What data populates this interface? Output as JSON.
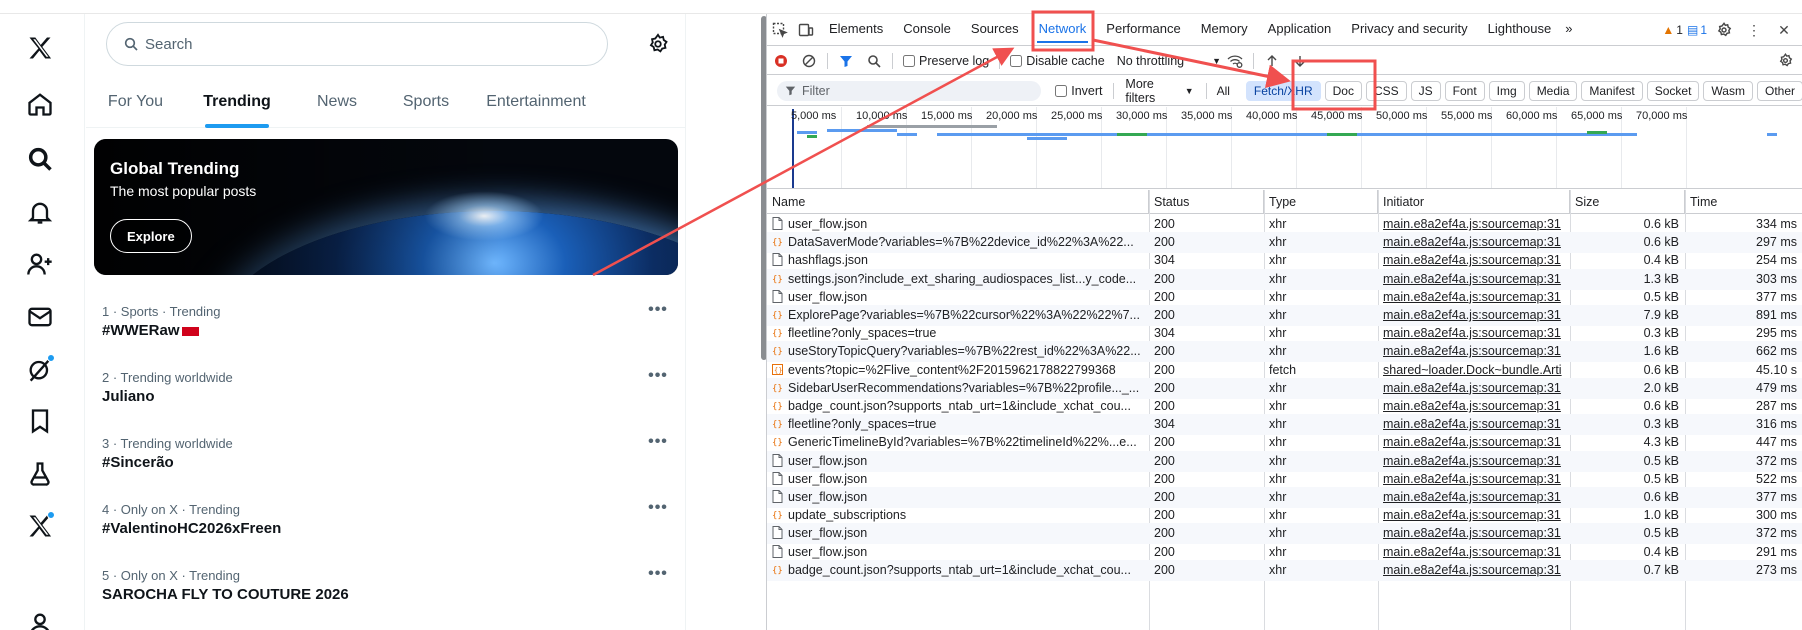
{
  "x_app": {
    "nav_icons": [
      "x-logo-icon",
      "home-icon",
      "search-icon",
      "bell-icon",
      "people-plus-icon",
      "mail-icon",
      "grok-slash-icon",
      "bookmark-icon",
      "flask-icon",
      "x-premium-icon",
      "profile-icon"
    ],
    "search": {
      "placeholder": "Search"
    },
    "tabs": [
      "For You",
      "Trending",
      "News",
      "Sports",
      "Entertainment"
    ],
    "active_tab": "Trending",
    "hero": {
      "title": "Global Trending",
      "subtitle": "The most popular posts",
      "button": "Explore"
    },
    "trends": [
      {
        "meta": "1 · Sports · Trending",
        "name": "#WWERaw"
      },
      {
        "meta": "2 · Trending worldwide",
        "name": "Juliano"
      },
      {
        "meta": "3 · Trending worldwide",
        "name": "#Sincerão"
      },
      {
        "meta": "4 · Only on X · Trending",
        "name": "#ValentinoHC2026xFreen"
      },
      {
        "meta": "5 · Only on X · Trending",
        "name": "SAROCHA FLY TO COUTURE 2026"
      }
    ],
    "more_glyph": "•••",
    "accent": "#1d9bf0"
  },
  "devtools": {
    "tabs": [
      "Elements",
      "Console",
      "Sources",
      "Network",
      "Performance",
      "Memory",
      "Application",
      "Privacy and security",
      "Lighthouse"
    ],
    "active_tab": "Network",
    "overflow": "»",
    "warnings": "1",
    "messages": "1",
    "toolbar": {
      "preserve_log": "Preserve log",
      "disable_cache": "Disable cache",
      "throttling": "No throttling"
    },
    "filter": {
      "placeholder": "Filter",
      "invert": "Invert",
      "more_filters": "More filters",
      "all": "All"
    },
    "type_filters": [
      "Fetch/XHR",
      "Doc",
      "CSS",
      "JS",
      "Font",
      "Img",
      "Media",
      "Manifest",
      "Socket",
      "Wasm",
      "Other"
    ],
    "active_type": "Fetch/XHR",
    "timeline_labels": [
      "5,000 ms",
      "10,000 ms",
      "15,000 ms",
      "20,000 ms",
      "25,000 ms",
      "30,000 ms",
      "35,000 ms",
      "40,000 ms",
      "45,000 ms",
      "50,000 ms",
      "55,000 ms",
      "60,000 ms",
      "65,000 ms",
      "70,000 ms"
    ],
    "columns": [
      "Name",
      "Status",
      "Type",
      "Initiator",
      "Size",
      "Time"
    ],
    "rows": [
      {
        "name": "user_flow.json",
        "icon": "doc",
        "status": "200",
        "type": "xhr",
        "initiator": "main.e8a2ef4a.js:sourcemap:31",
        "size": "0.6 kB",
        "time": "334 ms"
      },
      {
        "name": "DataSaverMode?variables=%7B%22device_id%22%3A%22...",
        "icon": "json",
        "status": "200",
        "type": "xhr",
        "initiator": "main.e8a2ef4a.js:sourcemap:31",
        "size": "0.6 kB",
        "time": "297 ms"
      },
      {
        "name": "hashflags.json",
        "icon": "doc",
        "status": "304",
        "type": "xhr",
        "initiator": "main.e8a2ef4a.js:sourcemap:31",
        "size": "0.4 kB",
        "time": "254 ms"
      },
      {
        "name": "settings.json?include_ext_sharing_audiospaces_list...y_code...",
        "icon": "json",
        "status": "200",
        "type": "xhr",
        "initiator": "main.e8a2ef4a.js:sourcemap:31",
        "size": "1.3 kB",
        "time": "303 ms"
      },
      {
        "name": "user_flow.json",
        "icon": "doc",
        "status": "200",
        "type": "xhr",
        "initiator": "main.e8a2ef4a.js:sourcemap:31",
        "size": "0.5 kB",
        "time": "377 ms"
      },
      {
        "name": "ExplorePage?variables=%7B%22cursor%22%3A%22%22%7...",
        "icon": "json",
        "status": "200",
        "type": "xhr",
        "initiator": "main.e8a2ef4a.js:sourcemap:31",
        "size": "7.9 kB",
        "time": "891 ms"
      },
      {
        "name": "fleetline?only_spaces=true",
        "icon": "json",
        "status": "304",
        "type": "xhr",
        "initiator": "main.e8a2ef4a.js:sourcemap:31",
        "size": "0.3 kB",
        "time": "295 ms"
      },
      {
        "name": "useStoryTopicQuery?variables=%7B%22rest_id%22%3A%22...",
        "icon": "json",
        "status": "200",
        "type": "xhr",
        "initiator": "main.e8a2ef4a.js:sourcemap:31",
        "size": "1.6 kB",
        "time": "662 ms"
      },
      {
        "name": "events?topic=%2Flive_content%2F2015962178822799368",
        "icon": "event",
        "status": "200",
        "type": "fetch",
        "initiator": "shared~loader.Dock~bundle.Arti",
        "size": "0.6 kB",
        "time": "45.10 s"
      },
      {
        "name": "SidebarUserRecommendations?variables=%7B%22profile..._...",
        "icon": "json",
        "status": "200",
        "type": "xhr",
        "initiator": "main.e8a2ef4a.js:sourcemap:31",
        "size": "2.0 kB",
        "time": "479 ms"
      },
      {
        "name": "badge_count.json?supports_ntab_urt=1&include_xchat_cou...",
        "icon": "json",
        "status": "200",
        "type": "xhr",
        "initiator": "main.e8a2ef4a.js:sourcemap:31",
        "size": "0.6 kB",
        "time": "287 ms"
      },
      {
        "name": "fleetline?only_spaces=true",
        "icon": "json",
        "status": "304",
        "type": "xhr",
        "initiator": "main.e8a2ef4a.js:sourcemap:31",
        "size": "0.3 kB",
        "time": "316 ms"
      },
      {
        "name": "GenericTimelineById?variables=%7B%22timelineId%22%...e...",
        "icon": "json",
        "status": "200",
        "type": "xhr",
        "initiator": "main.e8a2ef4a.js:sourcemap:31",
        "size": "4.3 kB",
        "time": "447 ms"
      },
      {
        "name": "user_flow.json",
        "icon": "doc",
        "status": "200",
        "type": "xhr",
        "initiator": "main.e8a2ef4a.js:sourcemap:31",
        "size": "0.5 kB",
        "time": "372 ms"
      },
      {
        "name": "user_flow.json",
        "icon": "doc",
        "status": "200",
        "type": "xhr",
        "initiator": "main.e8a2ef4a.js:sourcemap:31",
        "size": "0.5 kB",
        "time": "522 ms"
      },
      {
        "name": "user_flow.json",
        "icon": "doc",
        "status": "200",
        "type": "xhr",
        "initiator": "main.e8a2ef4a.js:sourcemap:31",
        "size": "0.6 kB",
        "time": "377 ms"
      },
      {
        "name": "update_subscriptions",
        "icon": "json",
        "status": "200",
        "type": "xhr",
        "initiator": "main.e8a2ef4a.js:sourcemap:31",
        "size": "1.0 kB",
        "time": "300 ms"
      },
      {
        "name": "user_flow.json",
        "icon": "doc",
        "status": "200",
        "type": "xhr",
        "initiator": "main.e8a2ef4a.js:sourcemap:31",
        "size": "0.5 kB",
        "time": "372 ms"
      },
      {
        "name": "user_flow.json",
        "icon": "doc",
        "status": "200",
        "type": "xhr",
        "initiator": "main.e8a2ef4a.js:sourcemap:31",
        "size": "0.4 kB",
        "time": "291 ms"
      },
      {
        "name": "badge_count.json?supports_ntab_urt=1&include_xchat_cou...",
        "icon": "json",
        "status": "200",
        "type": "xhr",
        "initiator": "main.e8a2ef4a.js:sourcemap:31",
        "size": "0.7 kB",
        "time": "273 ms"
      }
    ],
    "accent": "#1a73e8"
  },
  "annotations": {
    "color": "#f0504f"
  }
}
